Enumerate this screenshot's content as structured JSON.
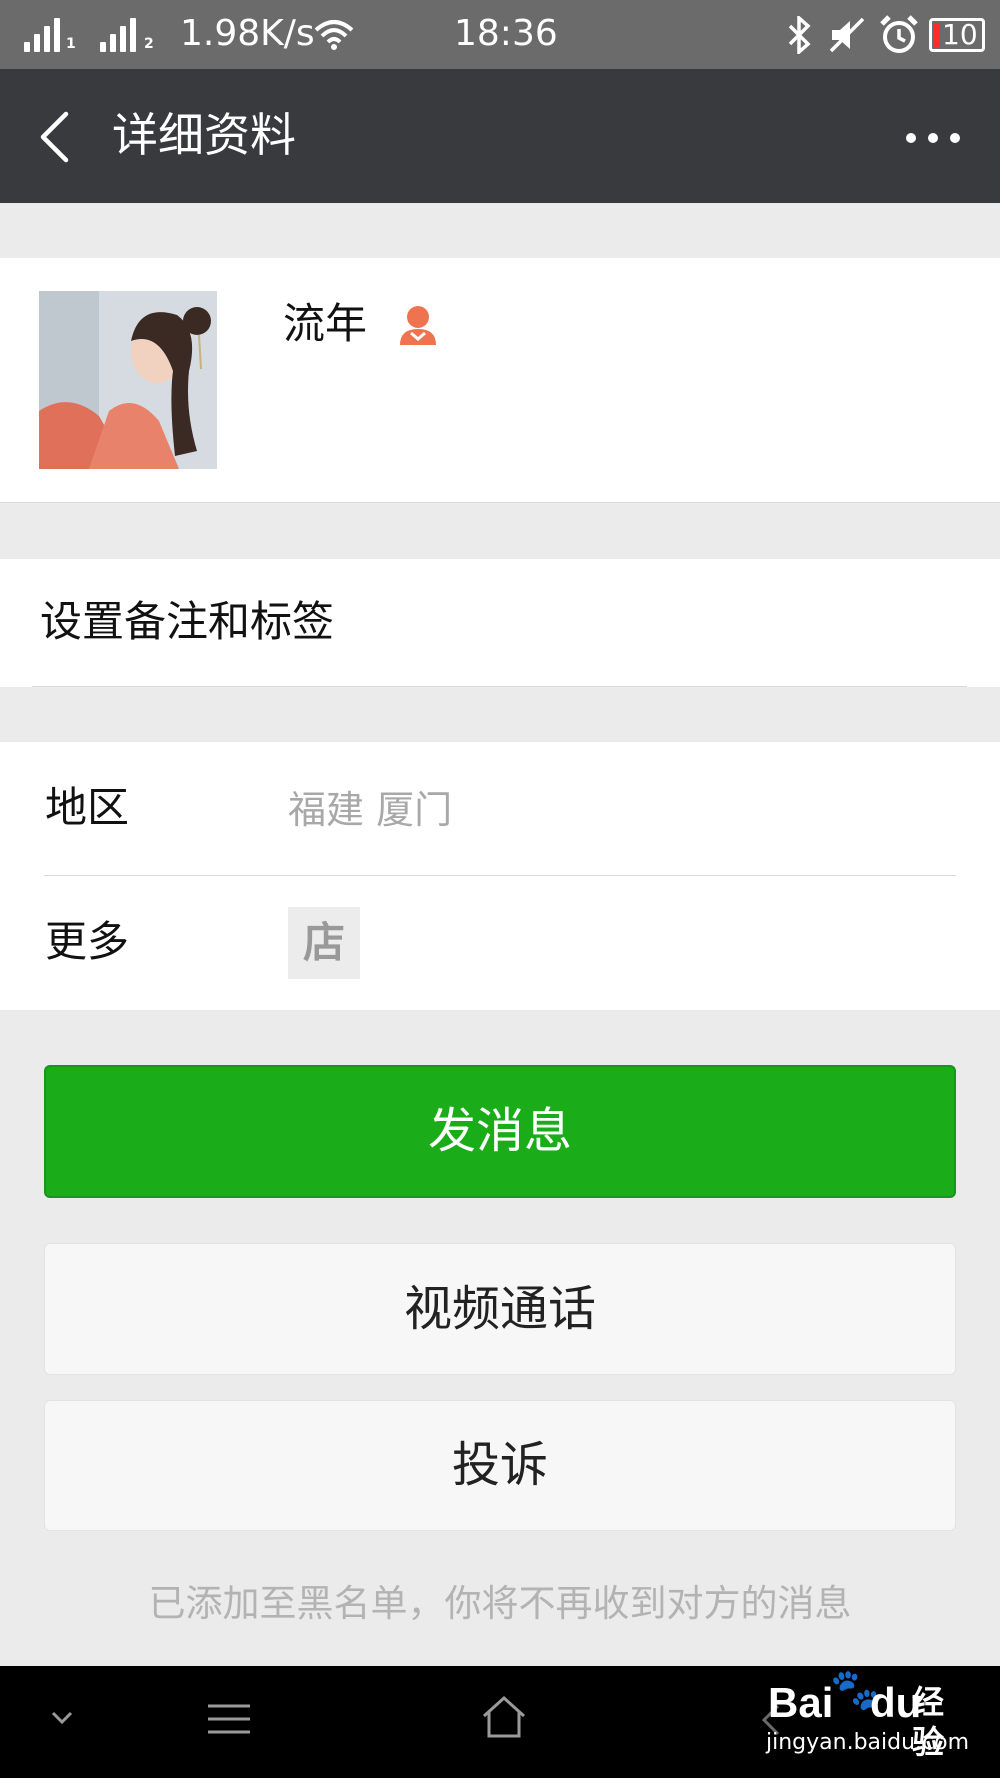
{
  "status_bar": {
    "sim1_label": "1",
    "sim2_label": "2",
    "network_speed": "1.98K/s",
    "time": "18:36",
    "battery": "10",
    "icons": [
      "signal-icon",
      "wifi-icon",
      "bluetooth-icon",
      "mute-icon",
      "alarm-icon",
      "battery-icon"
    ]
  },
  "nav": {
    "title": "详细资料",
    "back_icon": "chevron-left-icon",
    "more_icon": "more-dots-icon"
  },
  "profile": {
    "name": "流年",
    "gender_icon": "female-icon",
    "gender_color": "#f0734f"
  },
  "remark": {
    "label": "设置备注和标签"
  },
  "info": {
    "region_label": "地区",
    "region_value": "福建  厦门",
    "more_label": "更多",
    "shop_icon_text": "店"
  },
  "actions": {
    "send_message": "发消息",
    "video_call": "视频通话",
    "report": "投诉"
  },
  "notice": "已添加至黑名单，你将不再收到对方的消息",
  "watermark": {
    "brand": "Bai",
    "brand_suffix": "经验",
    "url": "jingyan.baidu.com"
  },
  "colors": {
    "nav_bg": "#393a3e",
    "primary_green": "#1aad19",
    "page_bg": "#ebebeb"
  }
}
